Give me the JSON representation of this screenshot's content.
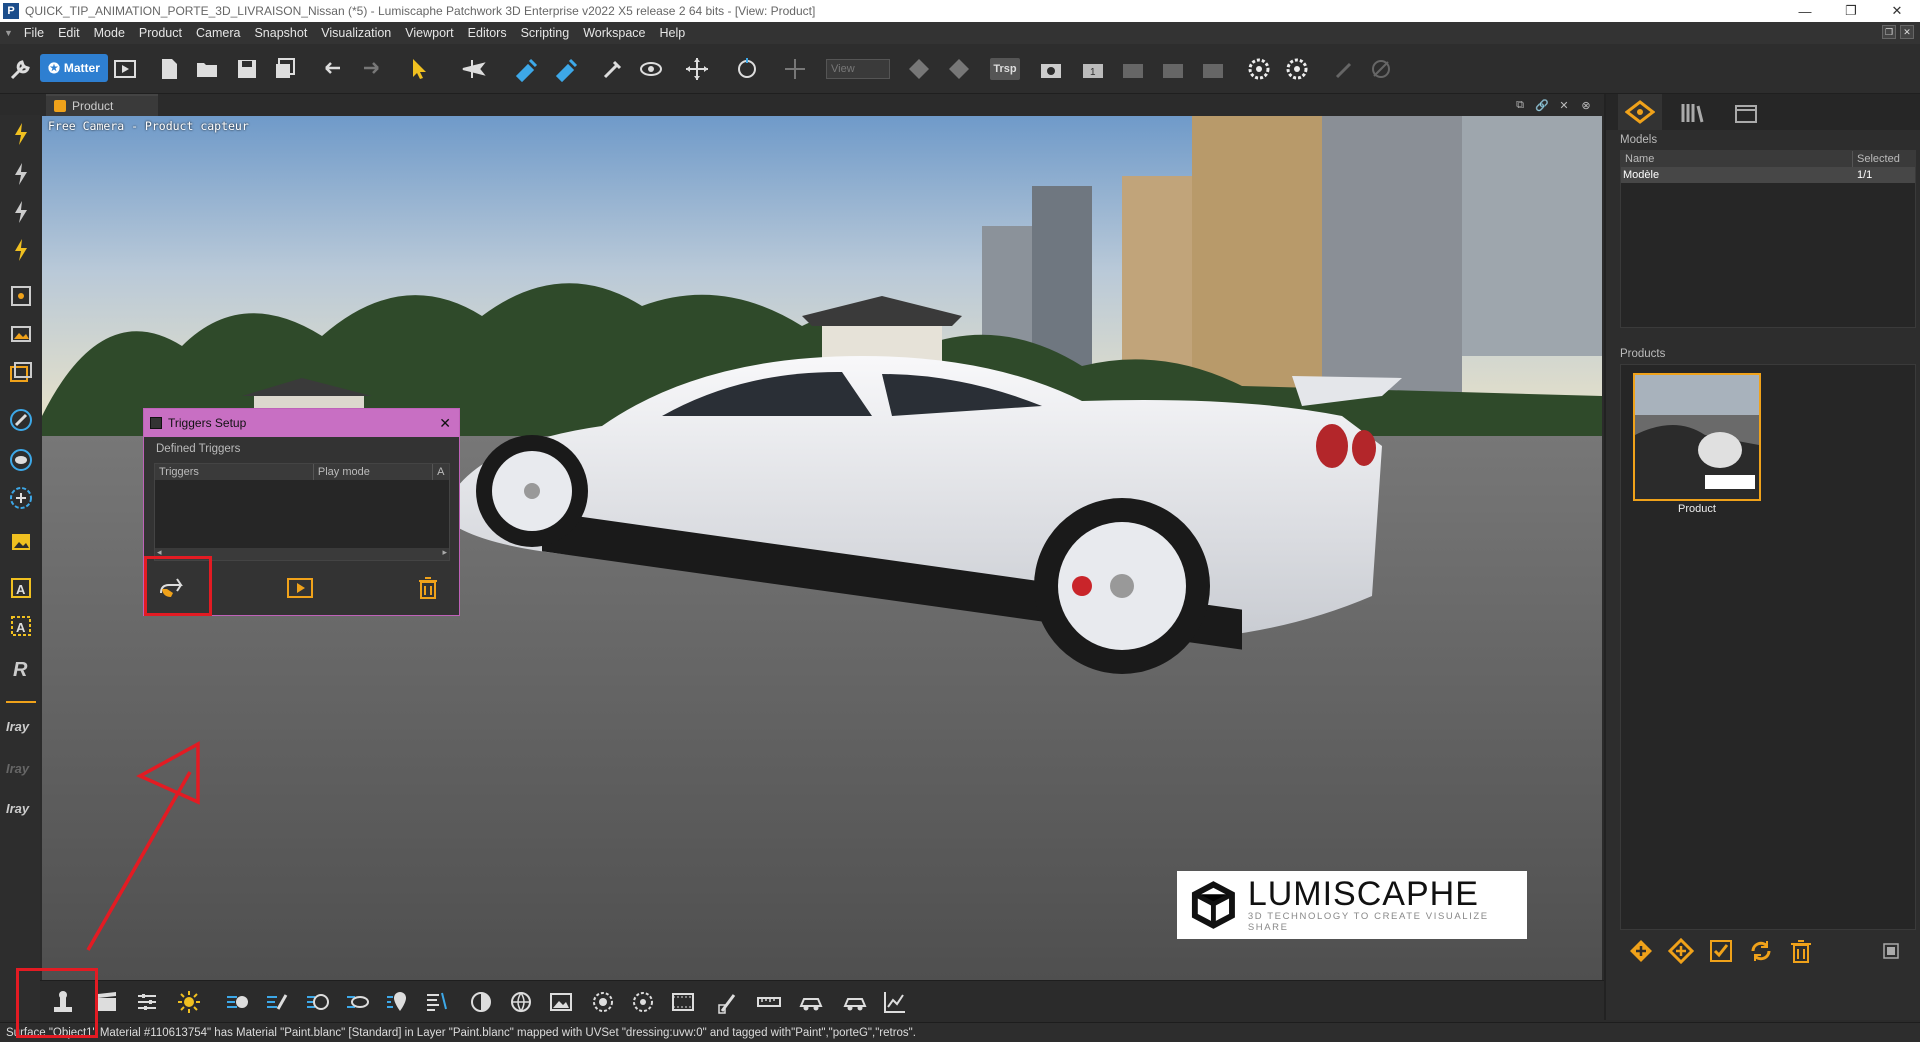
{
  "window": {
    "title": "QUICK_TIP_ANIMATION_PORTE_3D_LIVRAISON_Nissan (*5) - Lumiscaphe Patchwork 3D Enterprise v2022 X5 release 2 64 bits - [View: Product]",
    "app_logo": "P",
    "controls": [
      "—",
      "❐",
      "✕"
    ]
  },
  "menu": [
    "File",
    "Edit",
    "Mode",
    "Product",
    "Camera",
    "Snapshot",
    "Visualization",
    "Viewport",
    "Editors",
    "Scripting",
    "Workspace",
    "Help"
  ],
  "toolbar": {
    "matter_label": "Matter",
    "view_select": "View",
    "trsp_label": "Trsp"
  },
  "left_tools": {
    "iray_labels": [
      "Iray",
      "Iray",
      "Iray"
    ]
  },
  "doc_tab": {
    "label": "Product"
  },
  "viewport": {
    "camera_label": "Free Camera - Product capteur",
    "logo_main": "LUMISCAPHE",
    "logo_tag": "3D TECHNOLOGY TO CREATE VISUALIZE SHARE"
  },
  "triggers_dialog": {
    "title": "Triggers Setup",
    "section": "Defined Triggers",
    "columns": [
      "Triggers",
      "Play mode",
      "A"
    ]
  },
  "right_panel": {
    "models_label": "Models",
    "models_columns": [
      "Name",
      "Selected"
    ],
    "models_rows": [
      {
        "name": "Modèle",
        "selected": "1/1"
      }
    ],
    "products_label": "Products",
    "product_name": "Product"
  },
  "status": {
    "text": "Surface \"Object1\" Material #110613754\" has Material \"Paint.blanc\" [Standard] in Layer \"Paint.blanc\" mapped with UVSet \"dressing:uvw:0\" and tagged with\"Paint\",\"porteG\",\"retros\"."
  },
  "colors": {
    "accent_orange": "#f0a21a",
    "dialog_title": "#c86fc3",
    "highlight_red": "#e31b23",
    "matter_blue": "#2e7fd1"
  }
}
